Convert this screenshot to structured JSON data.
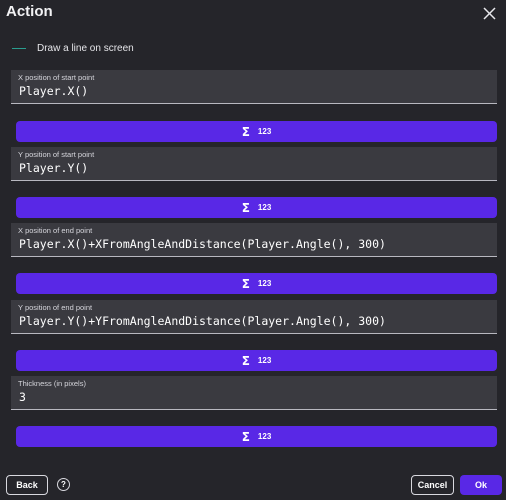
{
  "header": {
    "title": "Action",
    "close_icon": "close-icon"
  },
  "description": {
    "text": "Draw a line on screen",
    "icon": "line-icon",
    "icon_color": "#2a9d8f"
  },
  "parameters": [
    {
      "label": "X position of start point",
      "value": "Player.X()"
    },
    {
      "label": "Y position of start point",
      "value": "Player.Y()"
    },
    {
      "label": "X position of end point",
      "value": "Player.X()+XFromAngleAndDistance(Player.Angle(), 300)"
    },
    {
      "label": "Y position of end point",
      "value": "Player.Y()+YFromAngleAndDistance(Player.Angle(), 300)"
    },
    {
      "label": "Thickness (in pixels)",
      "value": "3"
    }
  ],
  "expression_button": {
    "sigma": "Σ",
    "text": "123",
    "color": "#5928e6"
  },
  "footer": {
    "back_label": "Back",
    "help_label": "?",
    "cancel_label": "Cancel",
    "ok_label": "Ok"
  },
  "colors": {
    "background": "#25252a",
    "field_bg": "#3a3a40",
    "accent": "#5928e6"
  }
}
